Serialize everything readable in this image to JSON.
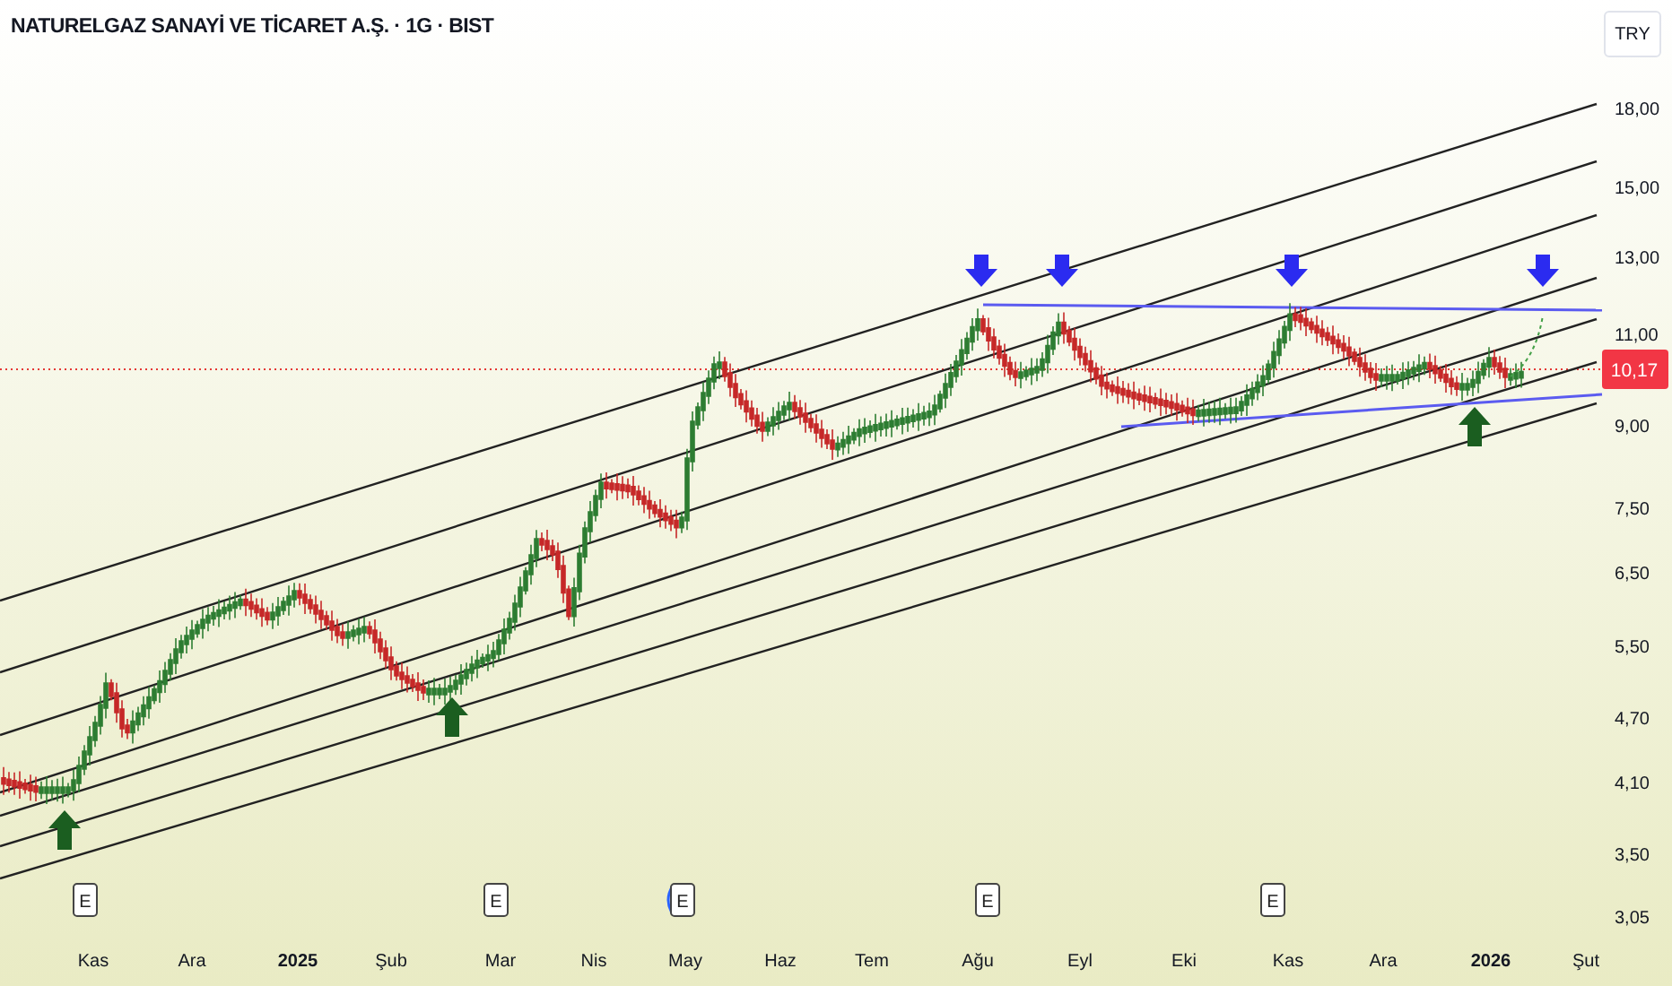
{
  "header": {
    "title": "NATURELGAZ SANAYİ VE TİCARET A.Ş. · 1G · BIST",
    "currency_button": "TRY"
  },
  "price_axis": {
    "labels": [
      "18,00",
      "15,00",
      "13,00",
      "11,00",
      "9,00",
      "7,50",
      "6,50",
      "5,50",
      "4,70",
      "4,10",
      "3,50",
      "3,05"
    ],
    "last_price": "10,17"
  },
  "earnings_markers": [
    {
      "label": "E",
      "highlighted": false
    },
    {
      "label": "E",
      "highlighted": false
    },
    {
      "label": "E",
      "highlighted": true
    },
    {
      "label": "E",
      "highlighted": false
    },
    {
      "label": "E",
      "highlighted": false
    }
  ],
  "time_axis": [
    {
      "text": "Kas",
      "kind": "month"
    },
    {
      "text": "Ara",
      "kind": "month"
    },
    {
      "text": "2025",
      "kind": "year"
    },
    {
      "text": "Şub",
      "kind": "month"
    },
    {
      "text": "Mar",
      "kind": "month"
    },
    {
      "text": "Nis",
      "kind": "month"
    },
    {
      "text": "May",
      "kind": "month"
    },
    {
      "text": "Haz",
      "kind": "month"
    },
    {
      "text": "Tem",
      "kind": "month"
    },
    {
      "text": "Ağu",
      "kind": "month"
    },
    {
      "text": "Eyl",
      "kind": "month"
    },
    {
      "text": "Eki",
      "kind": "month"
    },
    {
      "text": "Kas",
      "kind": "month"
    },
    {
      "text": "Ara",
      "kind": "month"
    },
    {
      "text": "2026",
      "kind": "year"
    },
    {
      "text": "Şut",
      "kind": "month"
    }
  ]
}
